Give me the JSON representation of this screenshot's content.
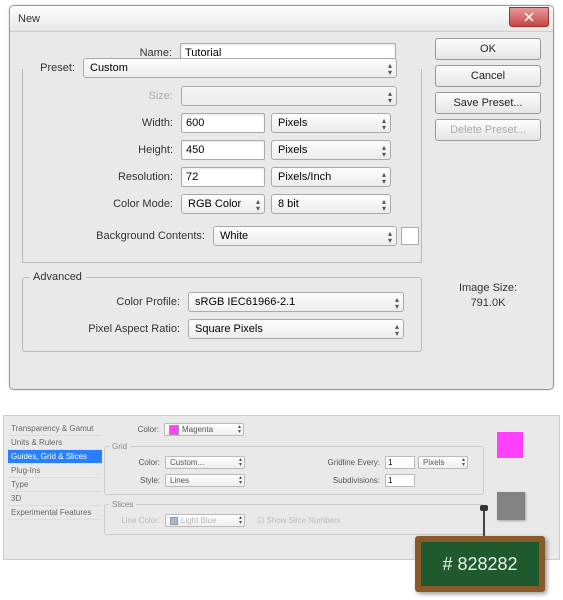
{
  "dialog": {
    "title": "New",
    "name_label": "Name:",
    "name_value": "Tutorial",
    "preset_label": "Preset:",
    "preset_value": "Custom",
    "size_label": "Size:",
    "size_value": "",
    "width_label": "Width:",
    "width_value": "600",
    "width_unit": "Pixels",
    "height_label": "Height:",
    "height_value": "450",
    "height_unit": "Pixels",
    "resolution_label": "Resolution:",
    "resolution_value": "72",
    "resolution_unit": "Pixels/Inch",
    "colormode_label": "Color Mode:",
    "colormode_value": "RGB Color",
    "bitdepth_value": "8 bit",
    "bgcontents_label": "Background Contents:",
    "bgcontents_value": "White",
    "advanced_label": "Advanced",
    "colorprofile_label": "Color Profile:",
    "colorprofile_value": "sRGB IEC61966-2.1",
    "pixelaspect_label": "Pixel Aspect Ratio:",
    "pixelaspect_value": "Square Pixels",
    "imagesize_label": "Image Size:",
    "imagesize_value": "791.0K",
    "buttons": {
      "ok": "OK",
      "cancel": "Cancel",
      "save_preset": "Save Preset...",
      "delete_preset": "Delete Preset..."
    }
  },
  "prefs": {
    "sidebar": [
      "Transparency & Gamut",
      "Units & Rulers",
      "Guides, Grid & Slices",
      "Plug-Ins",
      "Type",
      "3D",
      "Experimental Features"
    ],
    "selected_index": 2,
    "color_label": "Color:",
    "color_value": "Magenta",
    "grid_label": "Grid",
    "grid_color_label": "Color:",
    "grid_color_value": "Custom...",
    "grid_style_label": "Style:",
    "grid_style_value": "Lines",
    "gridline_label": "Gridline Every:",
    "gridline_value": "1",
    "gridline_unit": "Pixels",
    "subdivisions_label": "Subdivisions:",
    "subdivisions_value": "1",
    "slices_label": "Slices",
    "slice_linecolor_label": "Line Color:",
    "slice_linecolor_value": "Light Blue",
    "slice_shownumbers": "Show Slice Numbers"
  },
  "chalkboard": {
    "text": "# 828282"
  }
}
